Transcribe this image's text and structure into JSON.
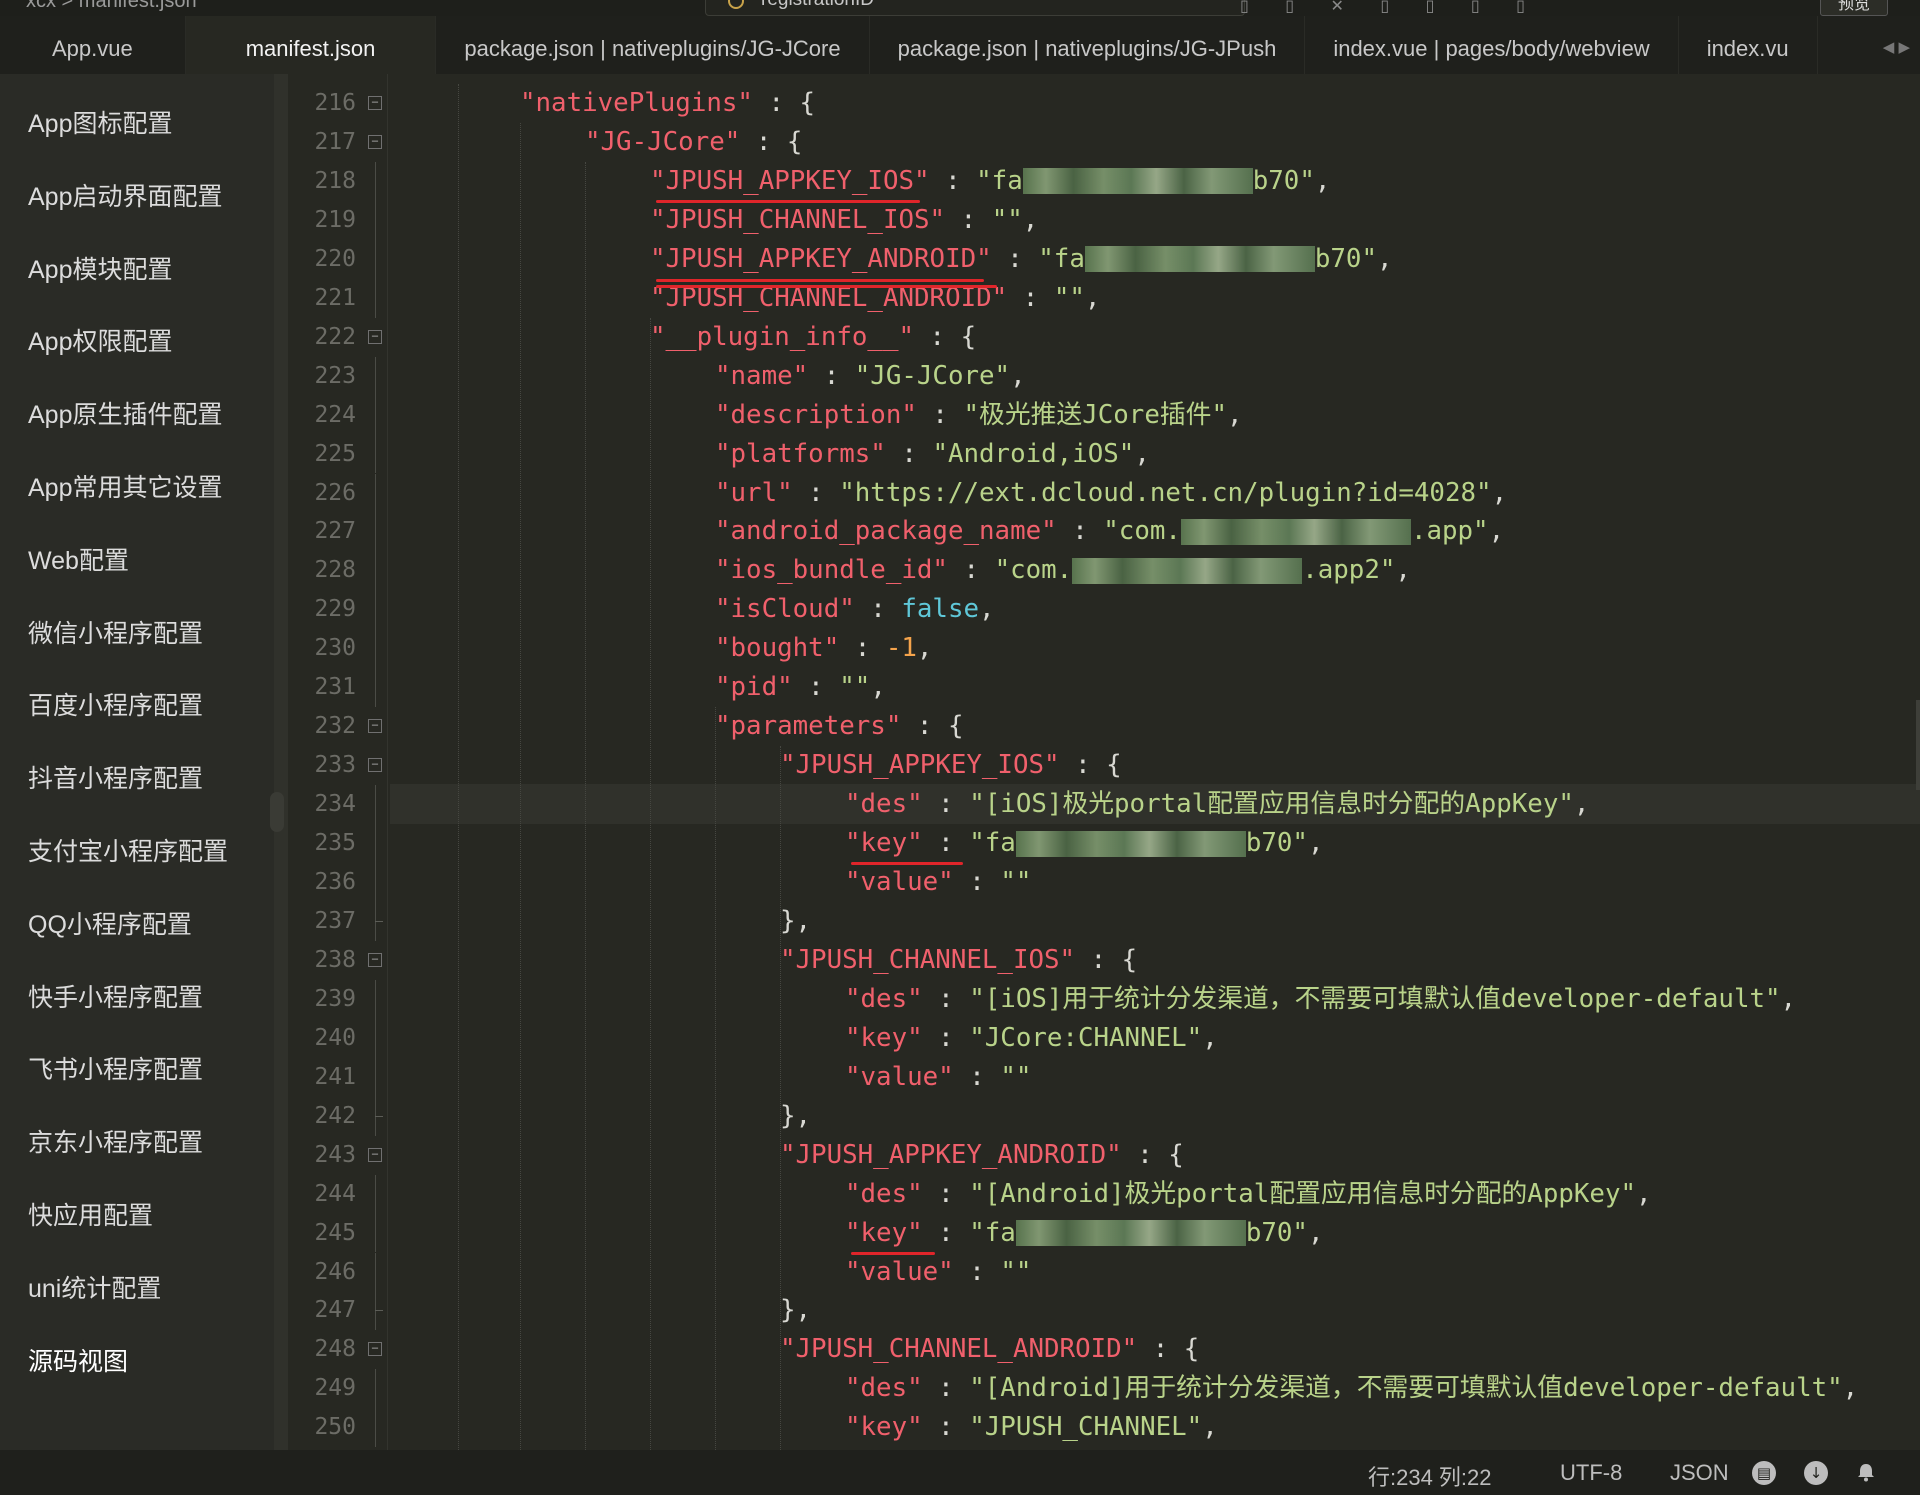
{
  "topbar": {
    "breadcrumb": "xcx  >  manifest.json",
    "search_text": "registrationID",
    "preview_label": "预览"
  },
  "tabs": [
    {
      "label": "App.vue",
      "active": false
    },
    {
      "label": "manifest.json",
      "active": true
    },
    {
      "label": "package.json | nativeplugins/JG-JCore",
      "active": false
    },
    {
      "label": "package.json | nativeplugins/JG-JPush",
      "active": false
    },
    {
      "label": "index.vue | pages/body/webview",
      "active": false
    },
    {
      "label": "index.vu",
      "active": false
    }
  ],
  "sidebar": {
    "items": [
      {
        "label": "App图标配置"
      },
      {
        "label": "App启动界面配置"
      },
      {
        "label": "App模块配置"
      },
      {
        "label": "App权限配置"
      },
      {
        "label": "App原生插件配置"
      },
      {
        "label": "App常用其它设置"
      },
      {
        "label": "Web配置"
      },
      {
        "label": "微信小程序配置"
      },
      {
        "label": "百度小程序配置"
      },
      {
        "label": "抖音小程序配置"
      },
      {
        "label": "支付宝小程序配置"
      },
      {
        "label": "QQ小程序配置"
      },
      {
        "label": "快手小程序配置"
      },
      {
        "label": "飞书小程序配置"
      },
      {
        "label": "京东小程序配置"
      },
      {
        "label": "快应用配置"
      },
      {
        "label": "uni统计配置"
      },
      {
        "label": "源码视图"
      }
    ]
  },
  "editor": {
    "current_line": "234",
    "lines": [
      {
        "num": "216",
        "indent": 1,
        "fold": "open",
        "tokens": [
          [
            "k",
            "\"nativePlugins\""
          ],
          [
            "p",
            " : {"
          ]
        ]
      },
      {
        "num": "217",
        "indent": 2,
        "fold": "open",
        "tokens": [
          [
            "k",
            "\"JG-JCore\""
          ],
          [
            "p",
            " : {"
          ]
        ]
      },
      {
        "num": "218",
        "indent": 3,
        "tokens": [
          [
            "k",
            "\"JPUSH_APPKEY_IOS\""
          ],
          [
            "p",
            " : "
          ],
          [
            "s",
            "\"fa"
          ],
          [
            "blur",
            ""
          ],
          [
            "s",
            "b70\""
          ],
          [
            "p",
            ","
          ]
        ]
      },
      {
        "num": "219",
        "indent": 3,
        "tokens": [
          [
            "k",
            "\"JPUSH_CHANNEL_IOS\""
          ],
          [
            "p",
            " : "
          ],
          [
            "s",
            "\"\""
          ],
          [
            "p",
            ","
          ]
        ]
      },
      {
        "num": "220",
        "indent": 3,
        "tokens": [
          [
            "k",
            "\"JPUSH_APPKEY_ANDROID\""
          ],
          [
            "p",
            " : "
          ],
          [
            "s",
            "\"fa"
          ],
          [
            "blur",
            ""
          ],
          [
            "s",
            "b70\""
          ],
          [
            "p",
            ","
          ]
        ]
      },
      {
        "num": "221",
        "indent": 3,
        "tokens": [
          [
            "k",
            "\"JPUSH_CHANNEL_ANDROID\""
          ],
          [
            "p",
            " : "
          ],
          [
            "s",
            "\"\""
          ],
          [
            "p",
            ","
          ]
        ]
      },
      {
        "num": "222",
        "indent": 3,
        "fold": "open",
        "tokens": [
          [
            "k",
            "\"__plugin_info__\""
          ],
          [
            "p",
            " : {"
          ]
        ]
      },
      {
        "num": "223",
        "indent": 4,
        "tokens": [
          [
            "k",
            "\"name\""
          ],
          [
            "p",
            " : "
          ],
          [
            "s",
            "\"JG-JCore\""
          ],
          [
            "p",
            ","
          ]
        ]
      },
      {
        "num": "224",
        "indent": 4,
        "tokens": [
          [
            "k",
            "\"description\""
          ],
          [
            "p",
            " : "
          ],
          [
            "s",
            "\"极光推送JCore插件\""
          ],
          [
            "p",
            ","
          ]
        ]
      },
      {
        "num": "225",
        "indent": 4,
        "tokens": [
          [
            "k",
            "\"platforms\""
          ],
          [
            "p",
            " : "
          ],
          [
            "s",
            "\"Android,iOS\""
          ],
          [
            "p",
            ","
          ]
        ]
      },
      {
        "num": "226",
        "indent": 4,
        "tokens": [
          [
            "k",
            "\"url\""
          ],
          [
            "p",
            " : "
          ],
          [
            "s",
            "\"https://ext.dcloud.net.cn/plugin?id=4028\""
          ],
          [
            "p",
            ","
          ]
        ]
      },
      {
        "num": "227",
        "indent": 4,
        "tokens": [
          [
            "k",
            "\"android_package_name\""
          ],
          [
            "p",
            " : "
          ],
          [
            "s",
            "\"com."
          ],
          [
            "blur",
            ""
          ],
          [
            "s",
            ".app\""
          ],
          [
            "p",
            ","
          ]
        ]
      },
      {
        "num": "228",
        "indent": 4,
        "tokens": [
          [
            "k",
            "\"ios_bundle_id\""
          ],
          [
            "p",
            " : "
          ],
          [
            "s",
            "\"com."
          ],
          [
            "blur",
            ""
          ],
          [
            "s",
            ".app2\""
          ],
          [
            "p",
            ","
          ]
        ]
      },
      {
        "num": "229",
        "indent": 4,
        "tokens": [
          [
            "k",
            "\"isCloud\""
          ],
          [
            "p",
            " : "
          ],
          [
            "b",
            "false"
          ],
          [
            "p",
            ","
          ]
        ]
      },
      {
        "num": "230",
        "indent": 4,
        "tokens": [
          [
            "k",
            "\"bought\""
          ],
          [
            "p",
            " : "
          ],
          [
            "n",
            "-1"
          ],
          [
            "p",
            ","
          ]
        ]
      },
      {
        "num": "231",
        "indent": 4,
        "tokens": [
          [
            "k",
            "\"pid\""
          ],
          [
            "p",
            " : "
          ],
          [
            "s",
            "\"\""
          ],
          [
            "p",
            ","
          ]
        ]
      },
      {
        "num": "232",
        "indent": 4,
        "fold": "open",
        "tokens": [
          [
            "k",
            "\"parameters\""
          ],
          [
            "p",
            " : {"
          ]
        ]
      },
      {
        "num": "233",
        "indent": 5,
        "fold": "open",
        "tokens": [
          [
            "k",
            "\"JPUSH_APPKEY_IOS\""
          ],
          [
            "p",
            " : {"
          ]
        ]
      },
      {
        "num": "234",
        "indent": 6,
        "tokens": [
          [
            "k",
            "\"des\""
          ],
          [
            "p",
            " : "
          ],
          [
            "s",
            "\"[iOS]极光portal配置应用信息时分配的AppKey\""
          ],
          [
            "p",
            ","
          ]
        ]
      },
      {
        "num": "235",
        "indent": 6,
        "tokens": [
          [
            "k",
            "\"key\""
          ],
          [
            "p",
            " : "
          ],
          [
            "s",
            "\"fa"
          ],
          [
            "blur",
            ""
          ],
          [
            "s",
            "b70\""
          ],
          [
            "p",
            ","
          ]
        ]
      },
      {
        "num": "236",
        "indent": 6,
        "tokens": [
          [
            "k",
            "\"value\""
          ],
          [
            "p",
            " : "
          ],
          [
            "s",
            "\"\""
          ]
        ]
      },
      {
        "num": "237",
        "indent": 5,
        "fold": "end",
        "tokens": [
          [
            "p",
            "},"
          ]
        ]
      },
      {
        "num": "238",
        "indent": 5,
        "fold": "open",
        "tokens": [
          [
            "k",
            "\"JPUSH_CHANNEL_IOS\""
          ],
          [
            "p",
            " : {"
          ]
        ]
      },
      {
        "num": "239",
        "indent": 6,
        "tokens": [
          [
            "k",
            "\"des\""
          ],
          [
            "p",
            " : "
          ],
          [
            "s",
            "\"[iOS]用于统计分发渠道，不需要可填默认值developer-default\""
          ],
          [
            "p",
            ","
          ]
        ]
      },
      {
        "num": "240",
        "indent": 6,
        "tokens": [
          [
            "k",
            "\"key\""
          ],
          [
            "p",
            " : "
          ],
          [
            "s",
            "\"JCore:CHANNEL\""
          ],
          [
            "p",
            ","
          ]
        ]
      },
      {
        "num": "241",
        "indent": 6,
        "tokens": [
          [
            "k",
            "\"value\""
          ],
          [
            "p",
            " : "
          ],
          [
            "s",
            "\"\""
          ]
        ]
      },
      {
        "num": "242",
        "indent": 5,
        "fold": "end",
        "tokens": [
          [
            "p",
            "},"
          ]
        ]
      },
      {
        "num": "243",
        "indent": 5,
        "fold": "open",
        "tokens": [
          [
            "k",
            "\"JPUSH_APPKEY_ANDROID\""
          ],
          [
            "p",
            " : {"
          ]
        ]
      },
      {
        "num": "244",
        "indent": 6,
        "tokens": [
          [
            "k",
            "\"des\""
          ],
          [
            "p",
            " : "
          ],
          [
            "s",
            "\"[Android]极光portal配置应用信息时分配的AppKey\""
          ],
          [
            "p",
            ","
          ]
        ]
      },
      {
        "num": "245",
        "indent": 6,
        "tokens": [
          [
            "k",
            "\"key\""
          ],
          [
            "p",
            " : "
          ],
          [
            "s",
            "\"fa"
          ],
          [
            "blur",
            ""
          ],
          [
            "s",
            "b70\""
          ],
          [
            "p",
            ","
          ]
        ]
      },
      {
        "num": "246",
        "indent": 6,
        "tokens": [
          [
            "k",
            "\"value\""
          ],
          [
            "p",
            " : "
          ],
          [
            "s",
            "\"\""
          ]
        ]
      },
      {
        "num": "247",
        "indent": 5,
        "fold": "end",
        "tokens": [
          [
            "p",
            "},"
          ]
        ]
      },
      {
        "num": "248",
        "indent": 5,
        "fold": "open",
        "tokens": [
          [
            "k",
            "\"JPUSH_CHANNEL_ANDROID\""
          ],
          [
            "p",
            " : {"
          ]
        ]
      },
      {
        "num": "249",
        "indent": 6,
        "tokens": [
          [
            "k",
            "\"des\""
          ],
          [
            "p",
            " : "
          ],
          [
            "s",
            "\"[Android]用于统计分发渠道，不需要可填默认值developer-default\""
          ],
          [
            "p",
            ","
          ]
        ]
      },
      {
        "num": "250",
        "indent": 6,
        "tokens": [
          [
            "k",
            "\"key\""
          ],
          [
            "p",
            " : "
          ],
          [
            "s",
            "\"JPUSH_CHANNEL\""
          ],
          [
            "p",
            ","
          ]
        ]
      }
    ]
  },
  "statusbar": {
    "position": "行:234  列:22",
    "encoding": "UTF-8",
    "language": "JSON"
  },
  "colors": {
    "background": "#272822",
    "key": "#f0606c",
    "string": "#b9d38a",
    "boolean": "#5fc7d8",
    "number": "#f5a44c",
    "annotation": "#e0252a"
  }
}
